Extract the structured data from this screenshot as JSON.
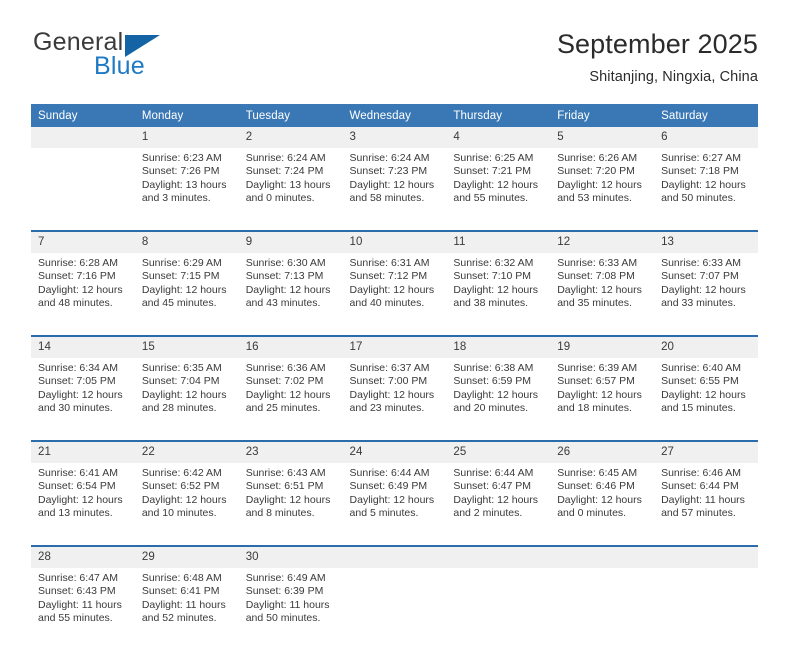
{
  "brand": {
    "name_part1": "General",
    "name_part2": "Blue",
    "triangle_color": "#1464a5",
    "blue_color": "#1e7ac4"
  },
  "header": {
    "title": "September 2025",
    "subtitle": "Shitanjing, Ningxia, China"
  },
  "theme": {
    "header_bar_color": "#3a78b5",
    "row_divider_color": "#2b6cad",
    "daynum_band_color": "#f0f0f0",
    "text_color": "#3a3a3a"
  },
  "weekday_headers": [
    "Sunday",
    "Monday",
    "Tuesday",
    "Wednesday",
    "Thursday",
    "Friday",
    "Saturday"
  ],
  "weeks": [
    [
      {
        "day": "",
        "sunrise": "",
        "sunset": "",
        "daylight1": "",
        "daylight2": ""
      },
      {
        "day": "1",
        "sunrise": "Sunrise: 6:23 AM",
        "sunset": "Sunset: 7:26 PM",
        "daylight1": "Daylight: 13 hours",
        "daylight2": "and 3 minutes."
      },
      {
        "day": "2",
        "sunrise": "Sunrise: 6:24 AM",
        "sunset": "Sunset: 7:24 PM",
        "daylight1": "Daylight: 13 hours",
        "daylight2": "and 0 minutes."
      },
      {
        "day": "3",
        "sunrise": "Sunrise: 6:24 AM",
        "sunset": "Sunset: 7:23 PM",
        "daylight1": "Daylight: 12 hours",
        "daylight2": "and 58 minutes."
      },
      {
        "day": "4",
        "sunrise": "Sunrise: 6:25 AM",
        "sunset": "Sunset: 7:21 PM",
        "daylight1": "Daylight: 12 hours",
        "daylight2": "and 55 minutes."
      },
      {
        "day": "5",
        "sunrise": "Sunrise: 6:26 AM",
        "sunset": "Sunset: 7:20 PM",
        "daylight1": "Daylight: 12 hours",
        "daylight2": "and 53 minutes."
      },
      {
        "day": "6",
        "sunrise": "Sunrise: 6:27 AM",
        "sunset": "Sunset: 7:18 PM",
        "daylight1": "Daylight: 12 hours",
        "daylight2": "and 50 minutes."
      }
    ],
    [
      {
        "day": "7",
        "sunrise": "Sunrise: 6:28 AM",
        "sunset": "Sunset: 7:16 PM",
        "daylight1": "Daylight: 12 hours",
        "daylight2": "and 48 minutes."
      },
      {
        "day": "8",
        "sunrise": "Sunrise: 6:29 AM",
        "sunset": "Sunset: 7:15 PM",
        "daylight1": "Daylight: 12 hours",
        "daylight2": "and 45 minutes."
      },
      {
        "day": "9",
        "sunrise": "Sunrise: 6:30 AM",
        "sunset": "Sunset: 7:13 PM",
        "daylight1": "Daylight: 12 hours",
        "daylight2": "and 43 minutes."
      },
      {
        "day": "10",
        "sunrise": "Sunrise: 6:31 AM",
        "sunset": "Sunset: 7:12 PM",
        "daylight1": "Daylight: 12 hours",
        "daylight2": "and 40 minutes."
      },
      {
        "day": "11",
        "sunrise": "Sunrise: 6:32 AM",
        "sunset": "Sunset: 7:10 PM",
        "daylight1": "Daylight: 12 hours",
        "daylight2": "and 38 minutes."
      },
      {
        "day": "12",
        "sunrise": "Sunrise: 6:33 AM",
        "sunset": "Sunset: 7:08 PM",
        "daylight1": "Daylight: 12 hours",
        "daylight2": "and 35 minutes."
      },
      {
        "day": "13",
        "sunrise": "Sunrise: 6:33 AM",
        "sunset": "Sunset: 7:07 PM",
        "daylight1": "Daylight: 12 hours",
        "daylight2": "and 33 minutes."
      }
    ],
    [
      {
        "day": "14",
        "sunrise": "Sunrise: 6:34 AM",
        "sunset": "Sunset: 7:05 PM",
        "daylight1": "Daylight: 12 hours",
        "daylight2": "and 30 minutes."
      },
      {
        "day": "15",
        "sunrise": "Sunrise: 6:35 AM",
        "sunset": "Sunset: 7:04 PM",
        "daylight1": "Daylight: 12 hours",
        "daylight2": "and 28 minutes."
      },
      {
        "day": "16",
        "sunrise": "Sunrise: 6:36 AM",
        "sunset": "Sunset: 7:02 PM",
        "daylight1": "Daylight: 12 hours",
        "daylight2": "and 25 minutes."
      },
      {
        "day": "17",
        "sunrise": "Sunrise: 6:37 AM",
        "sunset": "Sunset: 7:00 PM",
        "daylight1": "Daylight: 12 hours",
        "daylight2": "and 23 minutes."
      },
      {
        "day": "18",
        "sunrise": "Sunrise: 6:38 AM",
        "sunset": "Sunset: 6:59 PM",
        "daylight1": "Daylight: 12 hours",
        "daylight2": "and 20 minutes."
      },
      {
        "day": "19",
        "sunrise": "Sunrise: 6:39 AM",
        "sunset": "Sunset: 6:57 PM",
        "daylight1": "Daylight: 12 hours",
        "daylight2": "and 18 minutes."
      },
      {
        "day": "20",
        "sunrise": "Sunrise: 6:40 AM",
        "sunset": "Sunset: 6:55 PM",
        "daylight1": "Daylight: 12 hours",
        "daylight2": "and 15 minutes."
      }
    ],
    [
      {
        "day": "21",
        "sunrise": "Sunrise: 6:41 AM",
        "sunset": "Sunset: 6:54 PM",
        "daylight1": "Daylight: 12 hours",
        "daylight2": "and 13 minutes."
      },
      {
        "day": "22",
        "sunrise": "Sunrise: 6:42 AM",
        "sunset": "Sunset: 6:52 PM",
        "daylight1": "Daylight: 12 hours",
        "daylight2": "and 10 minutes."
      },
      {
        "day": "23",
        "sunrise": "Sunrise: 6:43 AM",
        "sunset": "Sunset: 6:51 PM",
        "daylight1": "Daylight: 12 hours",
        "daylight2": "and 8 minutes."
      },
      {
        "day": "24",
        "sunrise": "Sunrise: 6:44 AM",
        "sunset": "Sunset: 6:49 PM",
        "daylight1": "Daylight: 12 hours",
        "daylight2": "and 5 minutes."
      },
      {
        "day": "25",
        "sunrise": "Sunrise: 6:44 AM",
        "sunset": "Sunset: 6:47 PM",
        "daylight1": "Daylight: 12 hours",
        "daylight2": "and 2 minutes."
      },
      {
        "day": "26",
        "sunrise": "Sunrise: 6:45 AM",
        "sunset": "Sunset: 6:46 PM",
        "daylight1": "Daylight: 12 hours",
        "daylight2": "and 0 minutes."
      },
      {
        "day": "27",
        "sunrise": "Sunrise: 6:46 AM",
        "sunset": "Sunset: 6:44 PM",
        "daylight1": "Daylight: 11 hours",
        "daylight2": "and 57 minutes."
      }
    ],
    [
      {
        "day": "28",
        "sunrise": "Sunrise: 6:47 AM",
        "sunset": "Sunset: 6:43 PM",
        "daylight1": "Daylight: 11 hours",
        "daylight2": "and 55 minutes."
      },
      {
        "day": "29",
        "sunrise": "Sunrise: 6:48 AM",
        "sunset": "Sunset: 6:41 PM",
        "daylight1": "Daylight: 11 hours",
        "daylight2": "and 52 minutes."
      },
      {
        "day": "30",
        "sunrise": "Sunrise: 6:49 AM",
        "sunset": "Sunset: 6:39 PM",
        "daylight1": "Daylight: 11 hours",
        "daylight2": "and 50 minutes."
      },
      {
        "day": "",
        "sunrise": "",
        "sunset": "",
        "daylight1": "",
        "daylight2": ""
      },
      {
        "day": "",
        "sunrise": "",
        "sunset": "",
        "daylight1": "",
        "daylight2": ""
      },
      {
        "day": "",
        "sunrise": "",
        "sunset": "",
        "daylight1": "",
        "daylight2": ""
      },
      {
        "day": "",
        "sunrise": "",
        "sunset": "",
        "daylight1": "",
        "daylight2": ""
      }
    ]
  ]
}
